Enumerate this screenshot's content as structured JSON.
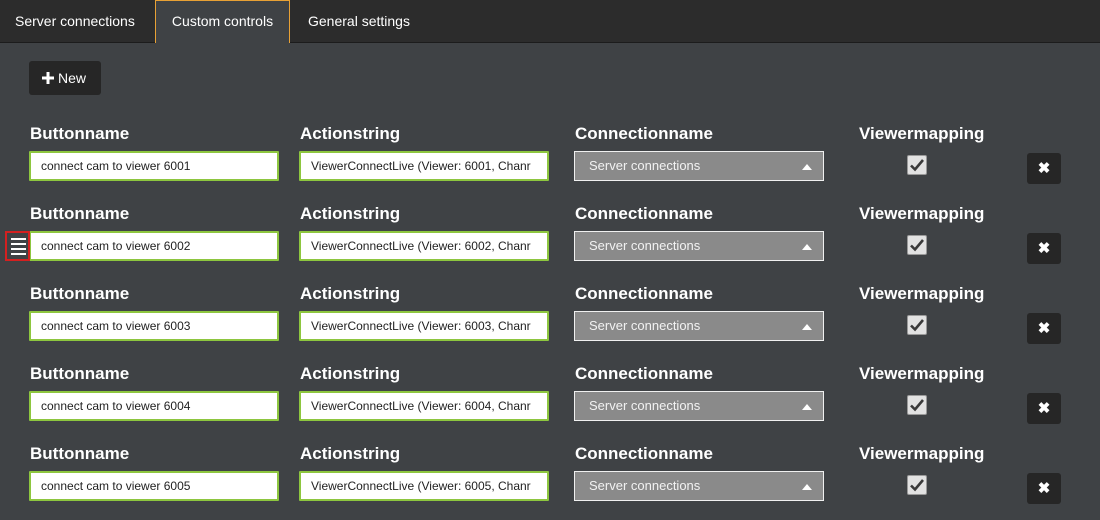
{
  "tabs": [
    {
      "label": "Server connections"
    },
    {
      "label": "Custom controls"
    },
    {
      "label": "General settings"
    }
  ],
  "new_button": {
    "label": "New"
  },
  "headers": {
    "buttonname": "Buttonname",
    "actionstring": "Actionstring",
    "connectionname": "Connectionname",
    "viewermapping": "Viewermapping"
  },
  "rows": [
    {
      "buttonname": "connect cam to viewer 6001",
      "actionstring": "ViewerConnectLive (Viewer: 6001, Chanr",
      "connection": "Server connections",
      "viewermapping": true
    },
    {
      "buttonname": "connect cam to viewer 6002",
      "actionstring": "ViewerConnectLive (Viewer: 6002, Chanr",
      "connection": "Server connections",
      "viewermapping": true
    },
    {
      "buttonname": "connect cam to viewer 6003",
      "actionstring": "ViewerConnectLive (Viewer: 6003, Chanr",
      "connection": "Server connections",
      "viewermapping": true
    },
    {
      "buttonname": "connect cam to viewer 6004",
      "actionstring": "ViewerConnectLive (Viewer: 6004, Chanr",
      "connection": "Server connections",
      "viewermapping": true
    },
    {
      "buttonname": "connect cam to viewer 6005",
      "actionstring": "ViewerConnectLive (Viewer: 6005, Chanr",
      "connection": "Server connections",
      "viewermapping": true
    }
  ],
  "delete_glyph": "✖",
  "colors": {
    "accent_tab": "#e8a135",
    "input_border": "#8dc63f",
    "drag_handle_border": "#d42020"
  }
}
